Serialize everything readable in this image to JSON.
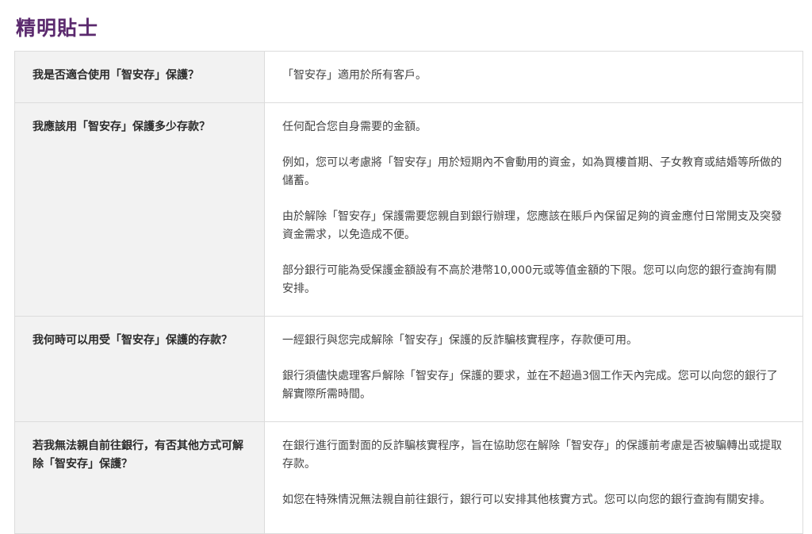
{
  "page": {
    "title": "精明貼士"
  },
  "faq": [
    {
      "question": "我是否適合使用「智安存」保護？",
      "answers": [
        "「智安存」適用於所有客戶。"
      ]
    },
    {
      "question": "我應該用「智安存」保護多少存款？",
      "answers": [
        "任何配合您自身需要的金額。",
        "例如，您可以考慮將「智安存」用於短期內不會動用的資金，如為買樓首期、子女教育或結婚等所做的儲蓄。",
        "由於解除「智安存」保護需要您親自到銀行辦理，您應該在賬戶內保留足夠的資金應付日常開支及突發資金需求，以免造成不便。",
        "部分銀行可能為受保護金額設有不高於港幣10,000元或等值金額的下限。您可以向您的銀行查詢有關安排。"
      ]
    },
    {
      "question": "我何時可以用受「智安存」保護的存款？",
      "answers": [
        "一經銀行與您完成解除「智安存」保護的反詐騙核實程序，存款便可用。",
        "銀行須儘快處理客戶解除「智安存」保護的要求，並在不超過3個工作天內完成。您可以向您的銀行了解實際所需時間。"
      ]
    },
    {
      "question": "若我無法親自前往銀行，有否其他方式可解除「智安存」保護？",
      "answers": [
        "在銀行進行面對面的反詐騙核實程序，旨在協助您在解除「智安存」的保護前考慮是否被騙轉出或提取存款。",
        "如您在特殊情況無法親自前往銀行，銀行可以安排其他核實方式。您可以向您的銀行查詢有關安排。"
      ]
    }
  ]
}
